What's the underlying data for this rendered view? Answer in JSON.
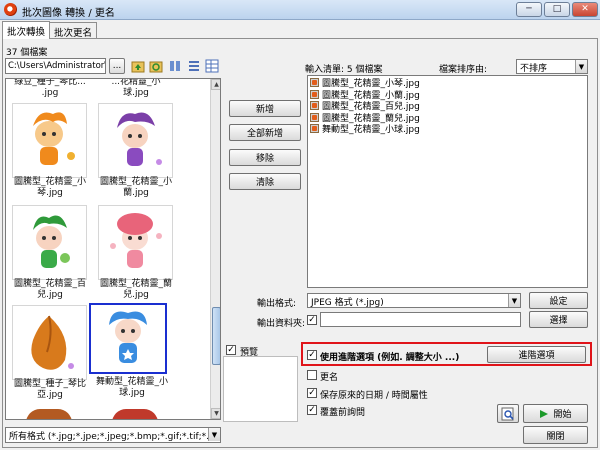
{
  "window": {
    "title": "批次圖像 轉換 / 更名",
    "minimize": "─",
    "maximize": "□",
    "close": "✕"
  },
  "tabs": [
    {
      "label": "批次轉換"
    },
    {
      "label": "批次更名"
    }
  ],
  "left": {
    "count": "37 個檔案",
    "path": "C:\\Users\\Administrator\\De",
    "browse": "...",
    "thumbs_top_partial": [
      "綠豆_種子_琴比...",
      "...花精靈_小"
    ],
    "thumbs_top_partial_ext": [
      ".jpg",
      "球.jpg"
    ],
    "thumbnails": [
      {
        "line1": "圖騰型_花精靈_小",
        "line2": "琴.jpg",
        "icon": "orange-flower-elf-icon"
      },
      {
        "line1": "圖騰型_花精靈_小",
        "line2": "蘭.jpg",
        "icon": "purple-flower-elf-icon"
      },
      {
        "line1": "圖騰型_花精靈_百",
        "line2": "兒.jpg",
        "icon": "green-flower-elf-icon"
      },
      {
        "line1": "圖騰型_花精靈_蘭",
        "line2": "兒.jpg",
        "icon": "pink-flower-elf-icon"
      },
      {
        "line1": "圖騰型_種子_琴比",
        "line2": "亞.jpg",
        "icon": "seed-icon"
      },
      {
        "line1": "舞動型_花精靈_小",
        "line2": "球.jpg",
        "icon": "blue-flower-elf-icon"
      }
    ],
    "filter": "所有格式 (*.jpg;*.jpe;*.jpeg;*.bmp;*.gif;*.tif;*.tiff;*"
  },
  "buttons": {
    "add": "新增",
    "add_all": "全部新增",
    "remove": "移除",
    "clear": "清除"
  },
  "input_list": {
    "label": "輸入清單: 5 個檔案",
    "sort_label": "檔案排序由:",
    "sort_value": "不排序",
    "files": [
      "圖騰型_花精靈_小琴.jpg",
      "圖騰型_花精靈_小蘭.jpg",
      "圖騰型_花精靈_百兒.jpg",
      "圖騰型_花精靈_蘭兒.jpg",
      "舞動型_花精靈_小球.jpg"
    ]
  },
  "output": {
    "format_label": "輸出格式:",
    "format_value": "JPEG 格式 (*.jpg)",
    "settings": "設定",
    "folder_label": "輸出資料夾:",
    "folder_checked": "✓",
    "folder_value": "",
    "browse": "選擇"
  },
  "options": {
    "preview": "預覽",
    "preview_checked": "✓",
    "advanced": "使用進階選項 (例如. 調整大小 ...)",
    "advanced_checked": "✓",
    "advanced_btn": "進階選項",
    "rename": "更名",
    "rename_checked": "",
    "keep_date": "保存原來的日期 / 時間屬性",
    "keep_date_checked": "✓",
    "overwrite": "覆蓋前詢問",
    "overwrite_checked": "✓"
  },
  "actions": {
    "start": "開始",
    "close": "關閉"
  },
  "colors": {
    "highlight_frame": "#e0141a",
    "selected_thumb": "#1a2fd0"
  }
}
